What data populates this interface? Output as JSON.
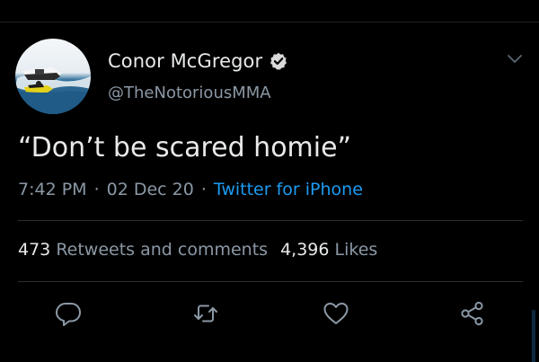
{
  "tweet": {
    "author": {
      "display_name": "Conor McGregor",
      "handle": "@TheNotoriousMMA",
      "verified": true
    },
    "text": "“Don’t be scared homie”",
    "time": "7:42 PM",
    "date": "02 Dec 20",
    "source": "Twitter for iPhone",
    "separator": "·",
    "stats": {
      "retweets_count": "473",
      "retweets_label": "Retweets and comments",
      "likes_count": "4,396",
      "likes_label": "Likes"
    }
  },
  "icons": {
    "verified": "verified-badge-icon",
    "menu": "chevron-down-icon",
    "reply": "reply-icon",
    "retweet": "retweet-icon",
    "like": "heart-icon",
    "share": "share-icon"
  },
  "colors": {
    "background": "#000000",
    "text": "#e7e9ea",
    "secondary": "#8b98a5",
    "link": "#1d9bf0",
    "divider": "#2a2e33"
  }
}
